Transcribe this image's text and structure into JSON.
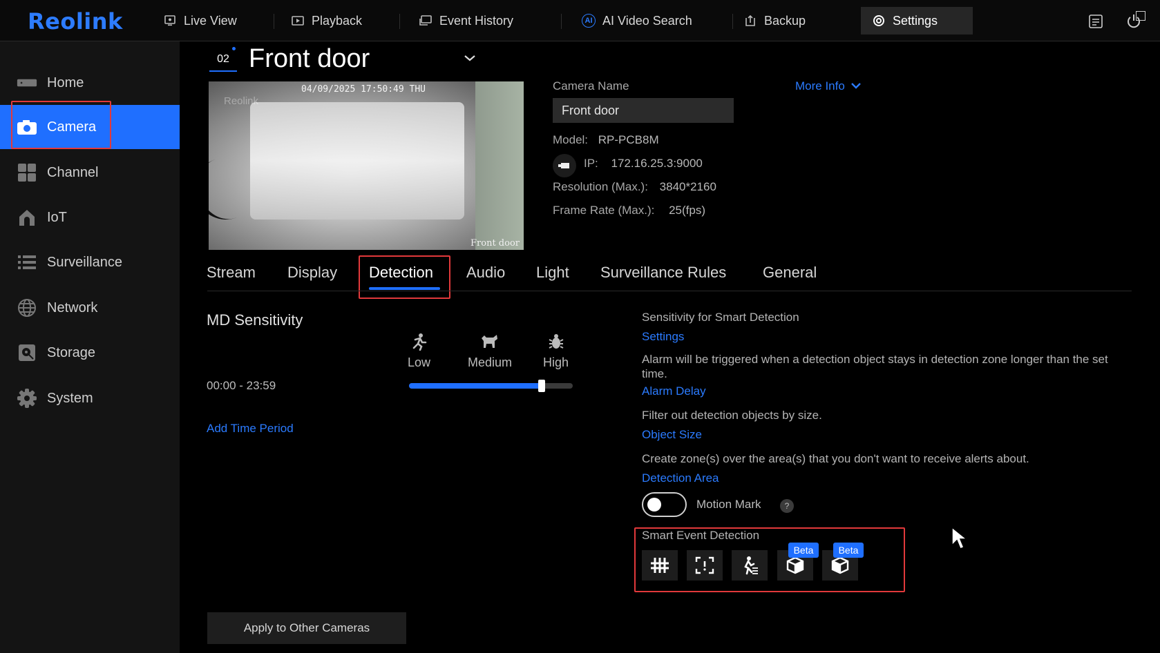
{
  "app": {
    "logo": "Reolink"
  },
  "nav": {
    "items": [
      {
        "label": "Live View",
        "icon": "monitor-icon"
      },
      {
        "label": "Playback",
        "icon": "playback-icon"
      },
      {
        "label": "Event History",
        "icon": "event-history-icon"
      },
      {
        "label": "AI Video Search",
        "icon": "ai-search-icon"
      },
      {
        "label": "Backup",
        "icon": "backup-icon"
      },
      {
        "label": "Settings",
        "icon": "settings-gear-icon",
        "active": true
      }
    ],
    "ai_badge": "AI"
  },
  "sidebar": {
    "items": [
      {
        "label": "Home",
        "icon": "home-icon"
      },
      {
        "label": "Camera",
        "icon": "camera-icon",
        "active": true
      },
      {
        "label": "Channel",
        "icon": "channel-grid-icon"
      },
      {
        "label": "IoT",
        "icon": "iot-house-icon"
      },
      {
        "label": "Surveillance",
        "icon": "list-icon"
      },
      {
        "label": "Network",
        "icon": "globe-icon"
      },
      {
        "label": "Storage",
        "icon": "storage-icon"
      },
      {
        "label": "System",
        "icon": "gear-icon"
      }
    ]
  },
  "channel": {
    "number": "02",
    "name": "Front door"
  },
  "preview": {
    "timestamp": "04/09/2025 17:50:49 THU",
    "watermark": "Reolink",
    "label": "Front door"
  },
  "camera_info": {
    "name_label": "Camera Name",
    "name_value": "Front door",
    "more_info": "More Info",
    "model_label": "Model:",
    "model_value": "RP-PCB8M",
    "ip_label": "IP:",
    "ip_value": "172.16.25.3:9000",
    "resolution_label": "Resolution (Max.):",
    "resolution_value": "3840*2160",
    "framerate_label": "Frame Rate (Max.):",
    "framerate_value": "25(fps)"
  },
  "tabs": [
    "Stream",
    "Display",
    "Detection",
    "Audio",
    "Light",
    "Surveillance Rules",
    "General"
  ],
  "active_tab": "Detection",
  "md": {
    "title": "MD Sensitivity",
    "levels": [
      "Low",
      "Medium",
      "High"
    ],
    "time_range": "00:00 - 23:59",
    "sensitivity_fraction": 0.81,
    "add_time_period": "Add Time Period",
    "apply_button": "Apply to Other Cameras"
  },
  "smart": {
    "sensitivity_text": "Sensitivity for Smart Detection",
    "settings_link": "Settings",
    "alarm_text": "Alarm will be triggered when a detection object stays in detection zone longer than the set time.",
    "alarm_link": "Alarm Delay",
    "filter_text": "Filter out detection objects by size.",
    "object_link": "Object Size",
    "zone_text": "Create zone(s) over the area(s) that you don't want to receive alerts about.",
    "area_link": "Detection Area",
    "motion_mark": "Motion Mark",
    "motion_mark_on": false,
    "help": "?",
    "sed_title": "Smart Event Detection",
    "sed_icons": [
      "crossline-icon",
      "intrusion-icon",
      "loitering-icon",
      "item-forgotten-icon",
      "item-taken-icon"
    ],
    "beta": "Beta"
  },
  "colors": {
    "accent": "#1f6fff",
    "highlight_box": "#e2393b",
    "background": "#000000",
    "sidebar": "#141414"
  }
}
